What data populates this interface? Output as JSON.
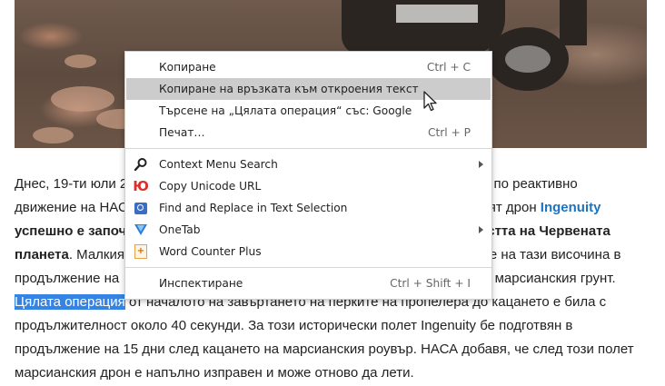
{
  "article": {
    "line1": {
      "start": "Днес, 19-ти юли 2",
      "end": "та по реактивно"
    },
    "line2": {
      "start": "движение на НАС",
      "end_plain": "кият дрон ",
      "link": "Ingenuity"
    },
    "line3": {
      "start_bold": "успешно е започ",
      "end_bold": "остта на Червената"
    },
    "line4": {
      "start_bold": "планета",
      "start_plain": ". Малкият",
      "end": "е на тази височина в"
    },
    "line5": {
      "start": "продължение на",
      "end": "ку марсианския грунт."
    },
    "line6": {
      "selected": "Цялата операция",
      "rest": " от началото на завъртането на перките на пропелера до кацането е била с"
    },
    "line7": "продължителност около 40 секунди. За този исторически полет Ingenuity бе подготвян в",
    "line8": "продължение на 15 дни след кацането на марсианския роувър. НАСА добавя, че след този полет",
    "line9": "марсианския дрон е напълно изправен и може отново да лети."
  },
  "context_menu": {
    "items": [
      {
        "label": "Копиране",
        "shortcut": "Ctrl + C"
      },
      {
        "label": "Копиране на връзката към откроения текст",
        "shortcut": ""
      },
      {
        "label": "Търсене на „Цялата операция“ със: Google",
        "shortcut": ""
      },
      {
        "label": "Печат…",
        "shortcut": "Ctrl + P"
      },
      {
        "label": "Context Menu Search",
        "icon": "magnifier-icon",
        "submenu": true
      },
      {
        "label": "Copy Unicode URL",
        "icon": "unicode-icon",
        "icon_glyph": "Ю"
      },
      {
        "label": "Find and Replace in Text Selection",
        "icon": "find-replace-icon"
      },
      {
        "label": "OneTab",
        "icon": "onetab-icon",
        "submenu": true
      },
      {
        "label": "Word Counter Plus",
        "icon": "word-counter-icon"
      },
      {
        "label": "Инспектиране",
        "shortcut": "Ctrl + Shift + I"
      }
    ]
  },
  "colors": {
    "selection": "#3584e4",
    "link": "#1e73be",
    "menu_hover": "#cccccc"
  }
}
